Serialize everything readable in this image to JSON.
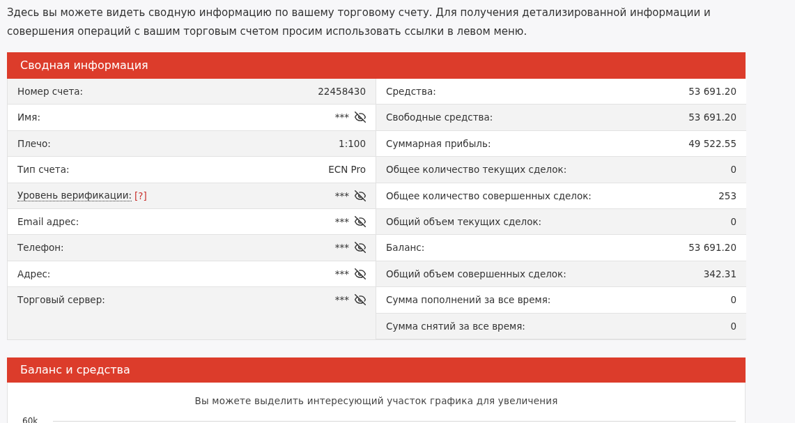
{
  "intro": "Здесь вы можете видеть сводную информацию по вашему торговому счету. Для получения детализированной информации и совершения операций с вашим торговым счетом просим использовать ссылки в левом меню.",
  "summary": {
    "title": "Сводная информация",
    "left_rows": [
      {
        "label": "Номер счета:",
        "value": "22458430",
        "masked": false
      },
      {
        "label": "Имя:",
        "value": "***",
        "masked": true
      },
      {
        "label": "Плечо:",
        "value": "1:100",
        "masked": false
      },
      {
        "label": "Тип счета:",
        "value": "ECN Pro",
        "masked": false
      },
      {
        "label": "Уровень верификации:",
        "help": "[?]",
        "value": "***",
        "masked": true
      },
      {
        "label": "Email адрес:",
        "value": "***",
        "masked": true
      },
      {
        "label": "Телефон:",
        "value": "***",
        "masked": true
      },
      {
        "label": "Адрес:",
        "value": "***",
        "masked": true
      },
      {
        "label": "Торговый сервер:",
        "value": "***",
        "masked": true
      }
    ],
    "right_rows": [
      {
        "label": "Средства:",
        "value": "53 691.20"
      },
      {
        "label": "Свободные средства:",
        "value": "53 691.20"
      },
      {
        "label": "Суммарная прибыль:",
        "value": "49 522.55"
      },
      {
        "label": "Общее количество текущих сделок:",
        "value": "0"
      },
      {
        "label": "Общее количество совершенных сделок:",
        "value": "253"
      },
      {
        "label": "Общий объем текущих сделок:",
        "value": "0"
      },
      {
        "label": "Баланс:",
        "value": "53 691.20"
      },
      {
        "label": "Общий объем совершенных сделок:",
        "value": "342.31"
      },
      {
        "label": "Сумма пополнений за все время:",
        "value": "0"
      },
      {
        "label": "Сумма снятий за все время:",
        "value": "0"
      }
    ]
  },
  "balance": {
    "title": "Баланс и средства",
    "chart": {
      "hint": "Вы можете выделить интересующий участок графика для увеличения",
      "y_axis_labels": [
        "60k"
      ]
    }
  }
}
